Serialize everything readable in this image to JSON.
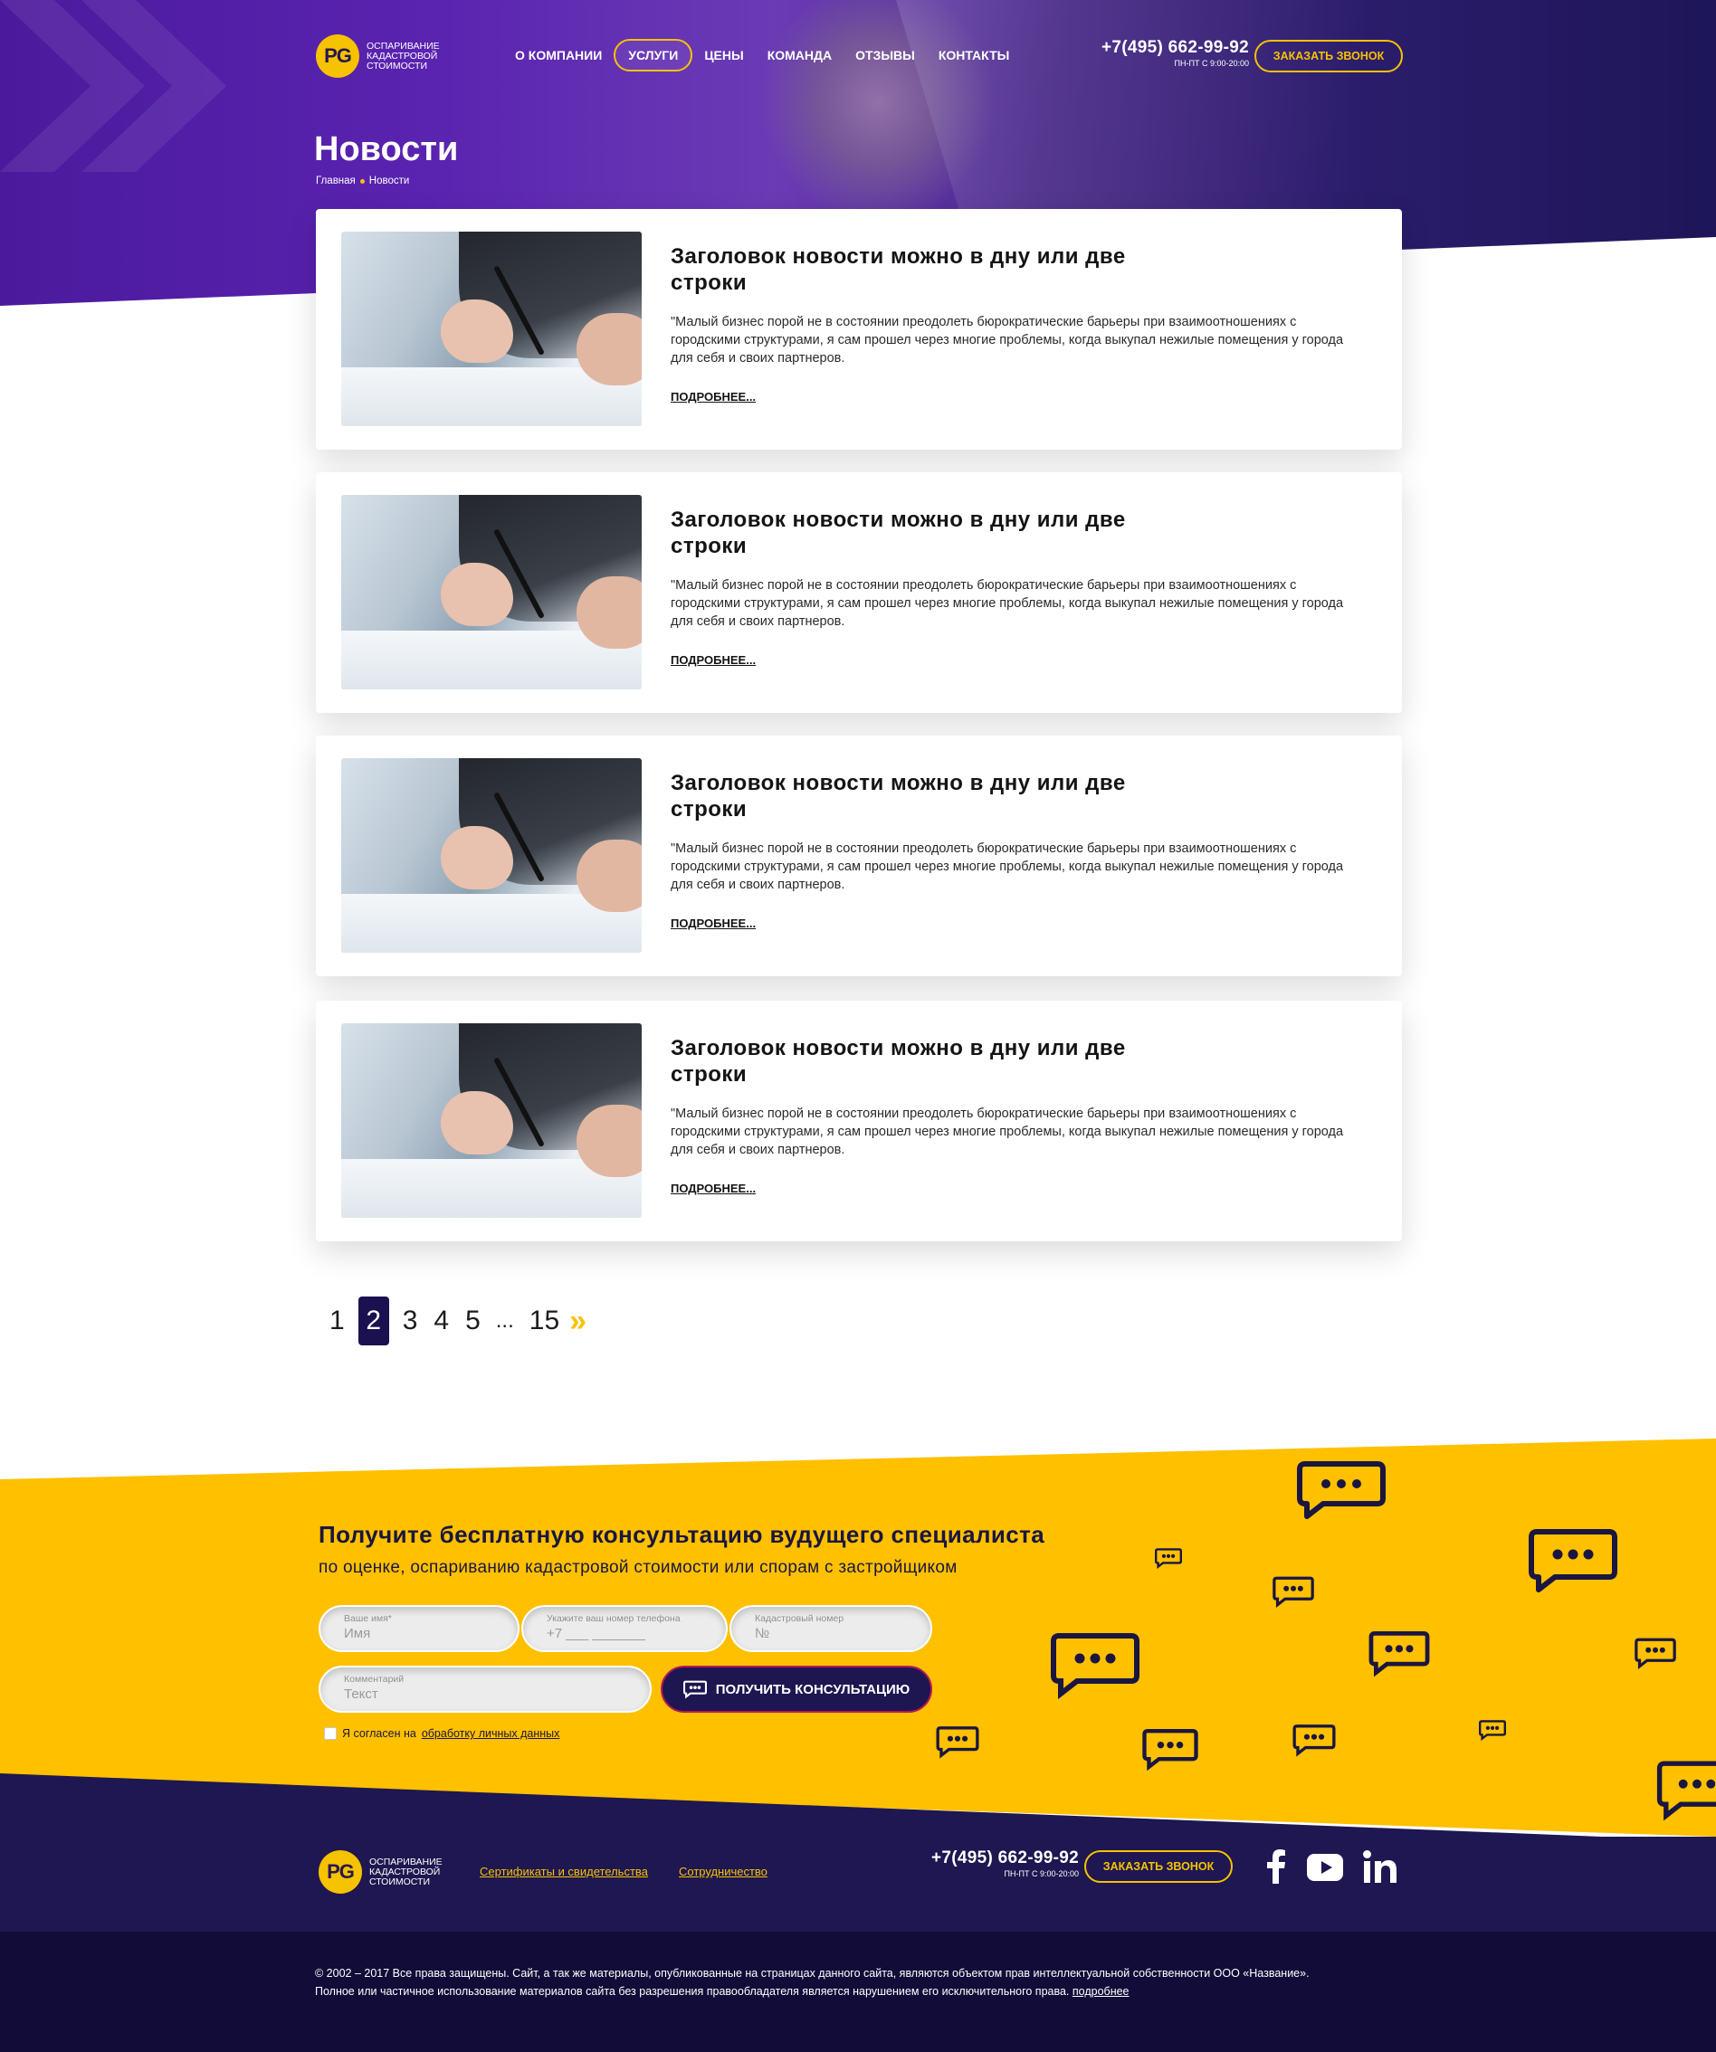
{
  "brand": {
    "logo_text": "PG",
    "tagline": "Оспаривание кадастровой стоимости"
  },
  "nav": {
    "items": [
      {
        "label": "О компании"
      },
      {
        "label": "Услуги"
      },
      {
        "label": "Цены"
      },
      {
        "label": "Команда"
      },
      {
        "label": "Отзывы"
      },
      {
        "label": "Контакты"
      }
    ],
    "active": "Услуги"
  },
  "header": {
    "phone": "+7(495) 662-99-92",
    "hours": "ПН-ПТ С 9:00-20:00",
    "callback_label": "Заказать звонок"
  },
  "page": {
    "title": "Новости",
    "breadcrumb": [
      "Главная",
      "Новости"
    ]
  },
  "news": [
    {
      "title": "Заголовок новости можно в дну или две строки",
      "excerpt": "\"Малый бизнес порой не в состоянии преодолеть бюрократические барьеры при взаимоотношениях с городскими структурами, я сам прошел через многие проблемы, когда выкупал нежилые помещения у города для себя и своих партнеров.",
      "more": "Подробнее..."
    },
    {
      "title": "Заголовок новости можно в дну или две строки",
      "excerpt": "\"Малый бизнес порой не в состоянии преодолеть бюрократические барьеры при взаимоотношениях с городскими структурами, я сам прошел через многие проблемы, когда выкупал нежилые помещения у города для себя и своих партнеров.",
      "more": "Подробнее..."
    },
    {
      "title": "Заголовок новости можно в дну или две строки",
      "excerpt": "\"Малый бизнес порой не в состоянии преодолеть бюрократические барьеры при взаимоотношениях с городскими структурами, я сам прошел через многие проблемы, когда выкупал нежилые помещения у города для себя и своих партнеров.",
      "more": "Подробнее..."
    },
    {
      "title": "Заголовок новости можно в дну или две строки",
      "excerpt": "\"Малый бизнес порой не в состоянии преодолеть бюрократические барьеры при взаимоотношениях с городскими структурами, я сам прошел через многие проблемы, когда выкупал нежилые помещения у города для себя и своих партнеров.",
      "more": "Подробнее..."
    }
  ],
  "pagination": {
    "pages": [
      "1",
      "2",
      "3",
      "4",
      "5"
    ],
    "current": "2",
    "ellipsis": "...",
    "last": "15",
    "next": "»"
  },
  "consultation": {
    "title": "Получите бесплатную консультацию вудущего специалиста",
    "subtitle": "по оценке, оспариванию кадастровой стоимости или спорам с застройщиком",
    "fields": {
      "name": {
        "label": "Ваше имя*",
        "placeholder": "Имя"
      },
      "phone": {
        "label": "Укажите ваш номер телефона",
        "placeholder": "+7   ___  _______"
      },
      "cadastral": {
        "label": "Кадастровый номер",
        "placeholder": "№"
      },
      "comment": {
        "label": "Комментарий",
        "placeholder": "Текст"
      }
    },
    "submit_label": "Получить консультацию",
    "consent_text": "Я согласен на",
    "consent_link": "обработку личных данных"
  },
  "footer": {
    "links": [
      "Сертификаты и свидетельства",
      "Сотрудничество"
    ],
    "phone": "+7(495) 662-99-92",
    "hours": "ПН-ПТ С 9:00-20:00",
    "callback_label": "Заказать звонок",
    "social": [
      "facebook-icon",
      "youtube-icon",
      "linkedin-icon"
    ],
    "copyright_line1": "© 2002 – 2017 Все права защищены. Сайт, а так же материалы, опубликованные на страницах данного сайта, являются объектом прав интеллектуальной собственности ООО «Название».",
    "copyright_line2": "Полное или частичное использование материалов сайта без разрешения правообладателя является нарушением его исключительного права.",
    "more_link": "подробнее"
  },
  "colors": {
    "accent": "#f7c200",
    "dark": "#1e1751",
    "hero_purple": "#4a1a9c",
    "cta_yellow": "#ffc000"
  }
}
